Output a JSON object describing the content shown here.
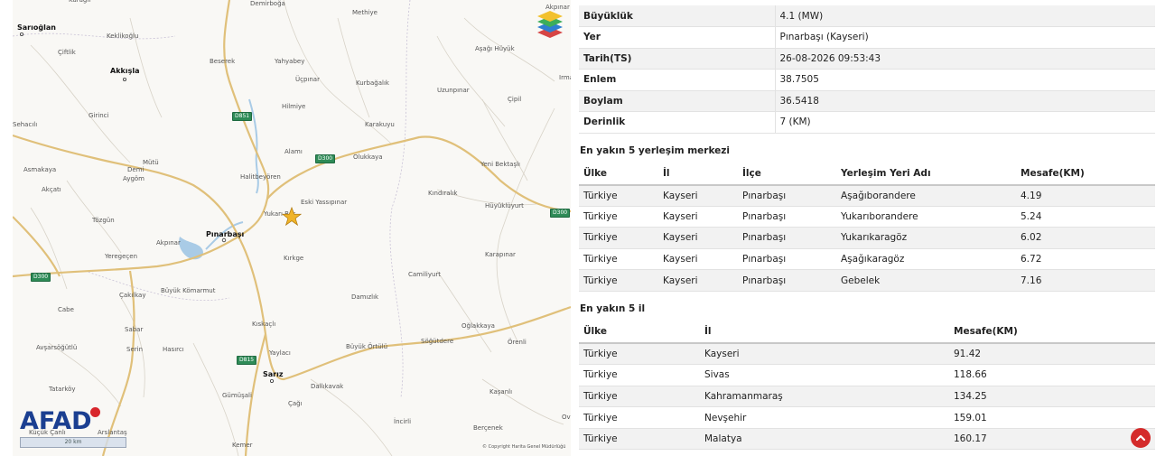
{
  "map": {
    "places": [
      {
        "name": "Sarıoğlan",
        "major": true
      },
      {
        "name": "Karağıl",
        "major": false
      },
      {
        "name": "Demirboğa",
        "major": false
      },
      {
        "name": "Methiye",
        "major": false
      },
      {
        "name": "Akpınar",
        "major": false
      },
      {
        "name": "Keklikoğlu",
        "major": false
      },
      {
        "name": "Çiftlik",
        "major": false
      },
      {
        "name": "Akkışla",
        "major": true
      },
      {
        "name": "Beserek",
        "major": false
      },
      {
        "name": "Yahyabey",
        "major": false
      },
      {
        "name": "Aşağı Hüyük",
        "major": false
      },
      {
        "name": "Üçpınar",
        "major": false
      },
      {
        "name": "Kurbağalık",
        "major": false
      },
      {
        "name": "Irmak",
        "major": false
      },
      {
        "name": "Uzunpınar",
        "major": false
      },
      {
        "name": "Hilmiye",
        "major": false
      },
      {
        "name": "Çipil",
        "major": false
      },
      {
        "name": "Girinci",
        "major": false
      },
      {
        "name": "Karakuyu",
        "major": false
      },
      {
        "name": "Sehacılı",
        "major": false
      },
      {
        "name": "Alamı",
        "major": false
      },
      {
        "name": "Olukkaya",
        "major": false
      },
      {
        "name": "Yeni Bektaşlı",
        "major": false
      },
      {
        "name": "Asmakaya",
        "major": false
      },
      {
        "name": "Mütü",
        "major": false
      },
      {
        "name": "Demi",
        "major": false
      },
      {
        "name": "Aygöm",
        "major": false
      },
      {
        "name": "Halitbeyören",
        "major": false
      },
      {
        "name": "Akçatı",
        "major": false
      },
      {
        "name": "Eski Yassıpınar",
        "major": false
      },
      {
        "name": "Kındıralık",
        "major": false
      },
      {
        "name": "Hüyüklüyurt",
        "major": false
      },
      {
        "name": "Tözgün",
        "major": false
      },
      {
        "name": "Yukarı Bar",
        "major": false
      },
      {
        "name": "Pınarbaşı",
        "major": true
      },
      {
        "name": "Akpınar",
        "major": false
      },
      {
        "name": "Karapınar",
        "major": false
      },
      {
        "name": "Yeregeçen",
        "major": false
      },
      {
        "name": "Kırkge",
        "major": false
      },
      {
        "name": "Camiliyurt",
        "major": false
      },
      {
        "name": "Çakılkay",
        "major": false
      },
      {
        "name": "Büyük Kömarmut",
        "major": false
      },
      {
        "name": "Damızlık",
        "major": false
      },
      {
        "name": "Cabe",
        "major": false
      },
      {
        "name": "Sabar",
        "major": false
      },
      {
        "name": "Kıskaçlı",
        "major": false
      },
      {
        "name": "Oğlakkaya",
        "major": false
      },
      {
        "name": "Avşarsöğütlü",
        "major": false
      },
      {
        "name": "Serin",
        "major": false
      },
      {
        "name": "Hasırcı",
        "major": false
      },
      {
        "name": "Yaylacı",
        "major": false
      },
      {
        "name": "Büyük Örtülü",
        "major": false
      },
      {
        "name": "Söğütdere",
        "major": false
      },
      {
        "name": "Örenli",
        "major": false
      },
      {
        "name": "Sarız",
        "major": true
      },
      {
        "name": "Tatarköy",
        "major": false
      },
      {
        "name": "Gümüşali",
        "major": false
      },
      {
        "name": "Dallıkavak",
        "major": false
      },
      {
        "name": "Kaşanlı",
        "major": false
      },
      {
        "name": "Çağı",
        "major": false
      },
      {
        "name": "İncirli",
        "major": false
      },
      {
        "name": "Berçenek",
        "major": false
      },
      {
        "name": "Arslantaş",
        "major": false
      },
      {
        "name": "Küçük Çanlı",
        "major": false
      },
      {
        "name": "Kemer",
        "major": false
      },
      {
        "name": "Ov",
        "major": false
      }
    ],
    "road_badges": [
      "D851",
      "D300",
      "D300",
      "D300",
      "D815"
    ],
    "logo": "AFAD",
    "scale_label": "20 km",
    "copyright": "© Copyright Harita Genel Müdürlüğü",
    "icons": {
      "layers": "layers-icon",
      "epicenter": "star-icon",
      "scroll_top": "chevron-up-icon"
    },
    "colors": {
      "road": "#e0c07a",
      "water": "#a9cbe6",
      "epicenter": "#f0b429",
      "badge": "#2e8b57",
      "logo": "#1b3f91",
      "scroll_top": "#d42b2b"
    }
  },
  "details": [
    {
      "label": "Büyüklük",
      "value": "4.1 (MW)"
    },
    {
      "label": "Yer",
      "value": "Pınarbaşı (Kayseri)"
    },
    {
      "label": "Tarih(TS)",
      "value": "26-08-2026 09:53:43"
    },
    {
      "label": "Enlem",
      "value": "38.7505"
    },
    {
      "label": "Boylam",
      "value": "36.5418"
    },
    {
      "label": "Derinlik",
      "value": "7 (KM)"
    }
  ],
  "settlements": {
    "title": "En yakın 5 yerleşim merkezi",
    "headers": [
      "Ülke",
      "İl",
      "İlçe",
      "Yerleşim Yeri Adı",
      "Mesafe(KM)"
    ],
    "rows": [
      [
        "Türkiye",
        "Kayseri",
        "Pınarbaşı",
        "Aşağıborandere",
        "4.19"
      ],
      [
        "Türkiye",
        "Kayseri",
        "Pınarbaşı",
        "Yukarıborandere",
        "5.24"
      ],
      [
        "Türkiye",
        "Kayseri",
        "Pınarbaşı",
        "Yukarıkaragöz",
        "6.02"
      ],
      [
        "Türkiye",
        "Kayseri",
        "Pınarbaşı",
        "Aşağıkaragöz",
        "6.72"
      ],
      [
        "Türkiye",
        "Kayseri",
        "Pınarbaşı",
        "Gebelek",
        "7.16"
      ]
    ]
  },
  "provinces": {
    "title": "En yakın 5 il",
    "headers": [
      "Ülke",
      "İl",
      "Mesafe(KM)"
    ],
    "rows": [
      [
        "Türkiye",
        "Kayseri",
        "91.42"
      ],
      [
        "Türkiye",
        "Sivas",
        "118.66"
      ],
      [
        "Türkiye",
        "Kahramanmaraş",
        "134.25"
      ],
      [
        "Türkiye",
        "Nevşehir",
        "159.01"
      ],
      [
        "Türkiye",
        "Malatya",
        "160.17"
      ]
    ]
  }
}
